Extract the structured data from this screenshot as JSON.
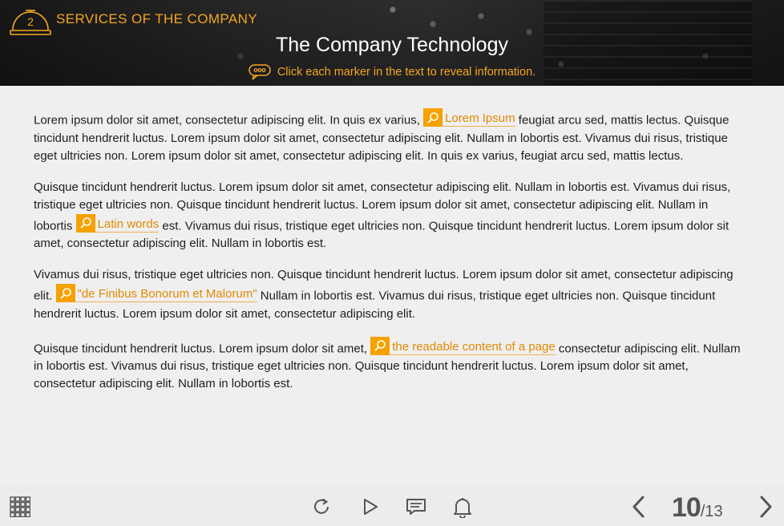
{
  "header": {
    "section_number": "2",
    "section_title": "SERVICES OF THE COMPANY",
    "page_title": "The Company Technology",
    "hint": "Click each marker in the text to reveal information.",
    "accent_color": "#f5a623"
  },
  "content": {
    "p1": {
      "before": "Lorem ipsum dolor sit amet, consectetur adipiscing elit. In quis ex varius,",
      "marker": "Lorem Ipsum",
      "after": "feugiat arcu sed, mattis lectus. Quisque tincidunt hendrerit luctus. Lorem ipsum dolor sit amet, consectetur adipiscing elit. Nullam in lobortis est. Vivamus dui risus, tristique eget ultricies non. Lorem ipsum dolor sit amet, consectetur adipiscing elit. In quis ex varius, feugiat arcu sed, mattis lectus."
    },
    "p2": {
      "before": "Quisque tincidunt hendrerit luctus. Lorem ipsum dolor sit amet, consectetur adipiscing elit. Nullam in lobortis est. Vivamus dui risus, tristique eget ultricies non. Quisque tincidunt hendrerit luctus. Lorem ipsum dolor sit amet, consectetur adipiscing elit. Nullam in lobortis",
      "marker": "Latin words",
      "after": "est. Vivamus dui risus, tristique eget ultricies non. Quisque tincidunt hendrerit luctus. Lorem ipsum dolor sit amet, consectetur adipiscing elit. Nullam in lobortis est."
    },
    "p3": {
      "before": "Vivamus dui risus, tristique eget ultricies non. Quisque tincidunt hendrerit luctus. Lorem ipsum dolor sit amet, consectetur adipiscing elit.",
      "marker": "\"de Finibus Bonorum et Malorum\"",
      "after": "Nullam in lobortis est. Vivamus dui risus, tristique eget ultricies non. Quisque tincidunt hendrerit luctus. Lorem ipsum dolor sit amet, consectetur adipiscing elit."
    },
    "p4": {
      "before": "Quisque tincidunt hendrerit luctus. Lorem ipsum dolor sit amet,",
      "marker": "the readable content of a page",
      "after": "consectetur adipiscing elit. Nullam in lobortis est. Vivamus dui risus, tristique eget ultricies non. Quisque tincidunt hendrerit luctus. Lorem ipsum dolor sit amet, consectetur adipiscing elit. Nullam in lobortis est."
    }
  },
  "footer": {
    "icons": [
      "grid-menu-icon",
      "replay-icon",
      "play-icon",
      "comments-icon",
      "notification-bell-icon",
      "prev-arrow-icon",
      "next-arrow-icon"
    ],
    "current_page": "10",
    "total_pages": "/13"
  }
}
